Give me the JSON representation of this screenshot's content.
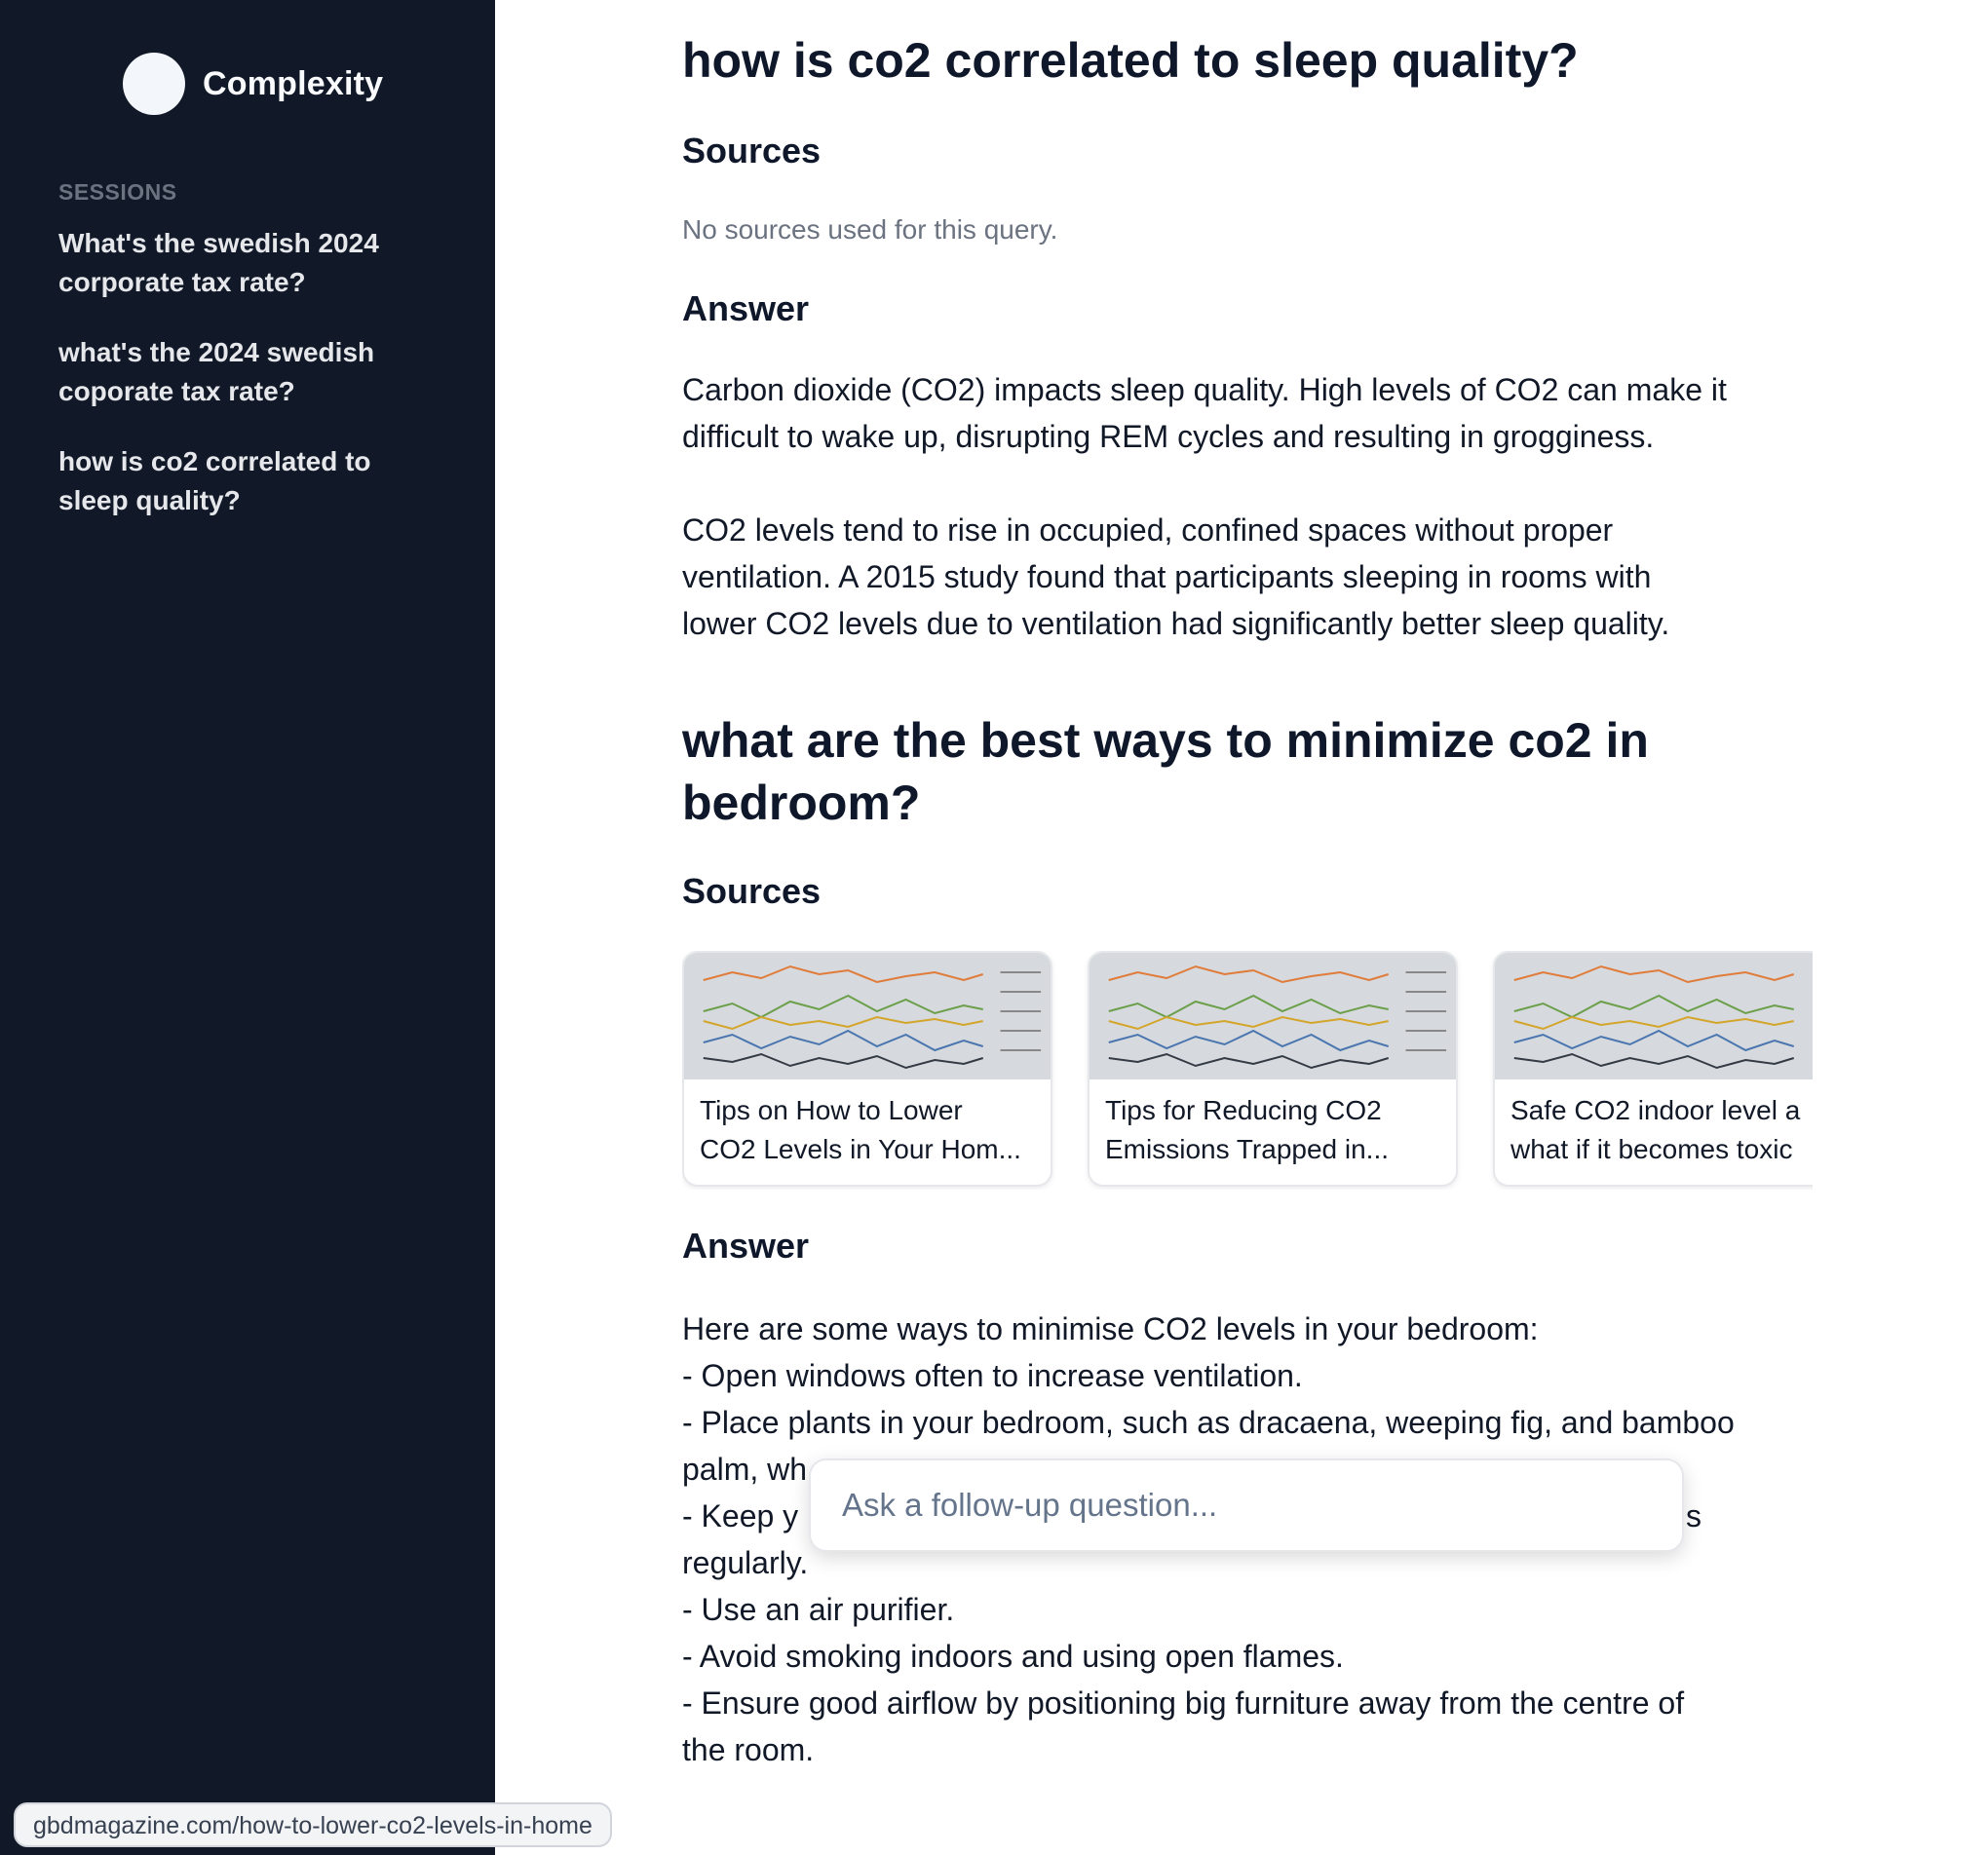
{
  "app": {
    "name": "Complexity"
  },
  "sidebar": {
    "sessions_label": "SESSIONS",
    "sessions": [
      {
        "line1": "What's the swedish 2024",
        "line2": "corporate tax rate?"
      },
      {
        "line1": "what's the 2024 swedish",
        "line2": "coporate tax rate?"
      },
      {
        "line1": "how is co2 correlated to",
        "line2": "sleep quality?"
      }
    ]
  },
  "thread": [
    {
      "query": "how is co2 correlated to sleep quality?",
      "sources_heading": "Sources",
      "no_sources_text": "No sources used for this query.",
      "answer_heading": "Answer",
      "answer_lines": [
        "Carbon dioxide (CO2) impacts sleep quality. High levels of CO2 can make it",
        "difficult to wake up, disrupting REM cycles and resulting in grogginess.",
        "CO2 levels tend to rise in occupied, confined spaces without proper",
        "ventilation. A 2015 study found that participants sleeping in rooms with",
        "lower CO2 levels due to ventilation had significantly better sleep quality."
      ]
    },
    {
      "query_line1": "what are the best ways to minimize co2 in",
      "query_line2": "bedroom?",
      "sources_heading": "Sources",
      "sources": [
        {
          "title_line1": "Tips on How to Lower",
          "title_line2": "CO2 Levels in Your Hom..."
        },
        {
          "title_line1": "Tips for Reducing CO2",
          "title_line2": "Emissions Trapped in..."
        },
        {
          "title_line1": "Safe CO2 indoor level a",
          "title_line2": "what if it becomes toxic"
        }
      ],
      "answer_heading": "Answer",
      "answer_lines": [
        "Here are some ways to minimise CO2 levels in your bedroom:",
        "- Open windows often to increase ventilation.",
        "- Place plants in your bedroom, such as dracaena, weeping fig, and bamboo",
        "palm, wh",
        "- Keep y",
        "s",
        "regularly.",
        "- Use an air purifier.",
        "- Avoid smoking indoors and using open flames.",
        "- Ensure good airflow by positioning big furniture away from the centre of",
        "the room."
      ]
    }
  ],
  "followup": {
    "placeholder": "Ask a follow-up question..."
  },
  "status_url": "gbdmagazine.com/how-to-lower-co2-levels-in-home",
  "colors": {
    "sidebar_bg": "#111827",
    "sidebar_text": "#e5e7eb",
    "muted": "#6b7280",
    "text": "#111827"
  }
}
